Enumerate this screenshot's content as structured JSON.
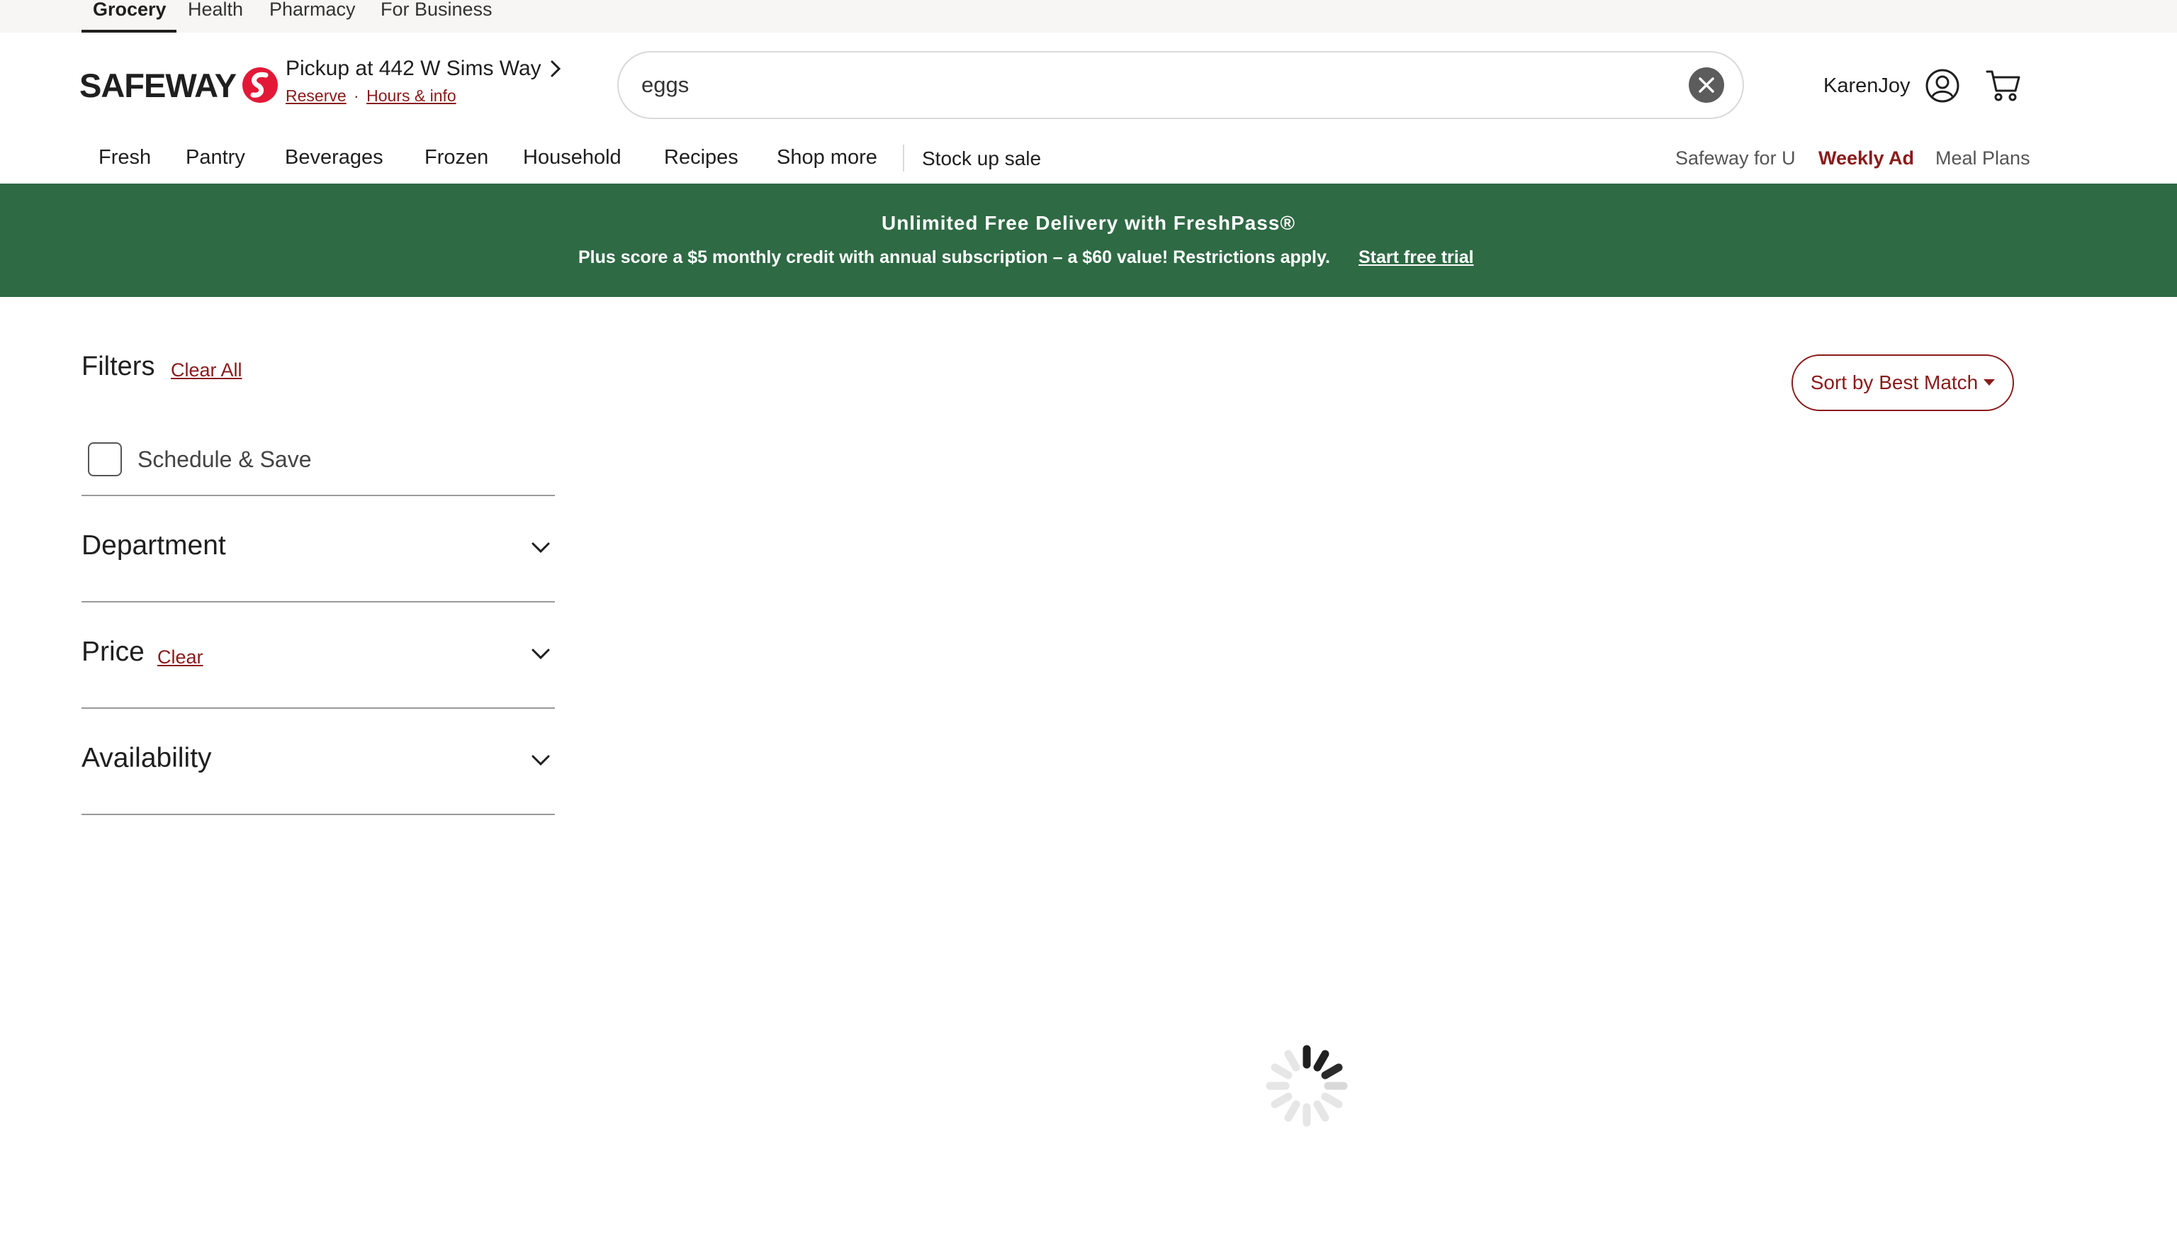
{
  "top_tabs": [
    {
      "label": "Grocery",
      "active": true
    },
    {
      "label": "Health",
      "active": false
    },
    {
      "label": "Pharmacy",
      "active": false
    },
    {
      "label": "For Business",
      "active": false
    }
  ],
  "header": {
    "logo_text": "SAFEWAY",
    "pickup": {
      "title": "Pickup at 442 W Sims Way",
      "reserve_label": "Reserve",
      "separator": "·",
      "hours_label": "Hours & info"
    },
    "search": {
      "value": "eggs",
      "placeholder": "Search"
    },
    "account_name": "KarenJoy"
  },
  "nav": {
    "items": [
      "Fresh",
      "Pantry",
      "Beverages",
      "Frozen",
      "Household",
      "Recipes",
      "Shop more"
    ],
    "sale_label": "Stock up sale",
    "right": {
      "safeway_for_u": "Safeway for U",
      "weekly_ad": "Weekly Ad",
      "meal_plans": "Meal Plans"
    }
  },
  "banner": {
    "title": "Unlimited Free Delivery with FreshPass®",
    "subtitle": "Plus score a $5 monthly credit with annual subscription – a $60 value! Restrictions apply.",
    "link": "Start free trial"
  },
  "filters": {
    "title": "Filters",
    "clear_all": "Clear All",
    "schedule_save": "Schedule & Save",
    "facets": {
      "department": "Department",
      "price": "Price",
      "price_clear": "Clear",
      "availability": "Availability"
    }
  },
  "sort": {
    "label": "Sort by Best Match"
  },
  "colors": {
    "brand_red": "#8a1b1b",
    "banner_green": "#2e6a44",
    "logo_red": "#e31837"
  }
}
